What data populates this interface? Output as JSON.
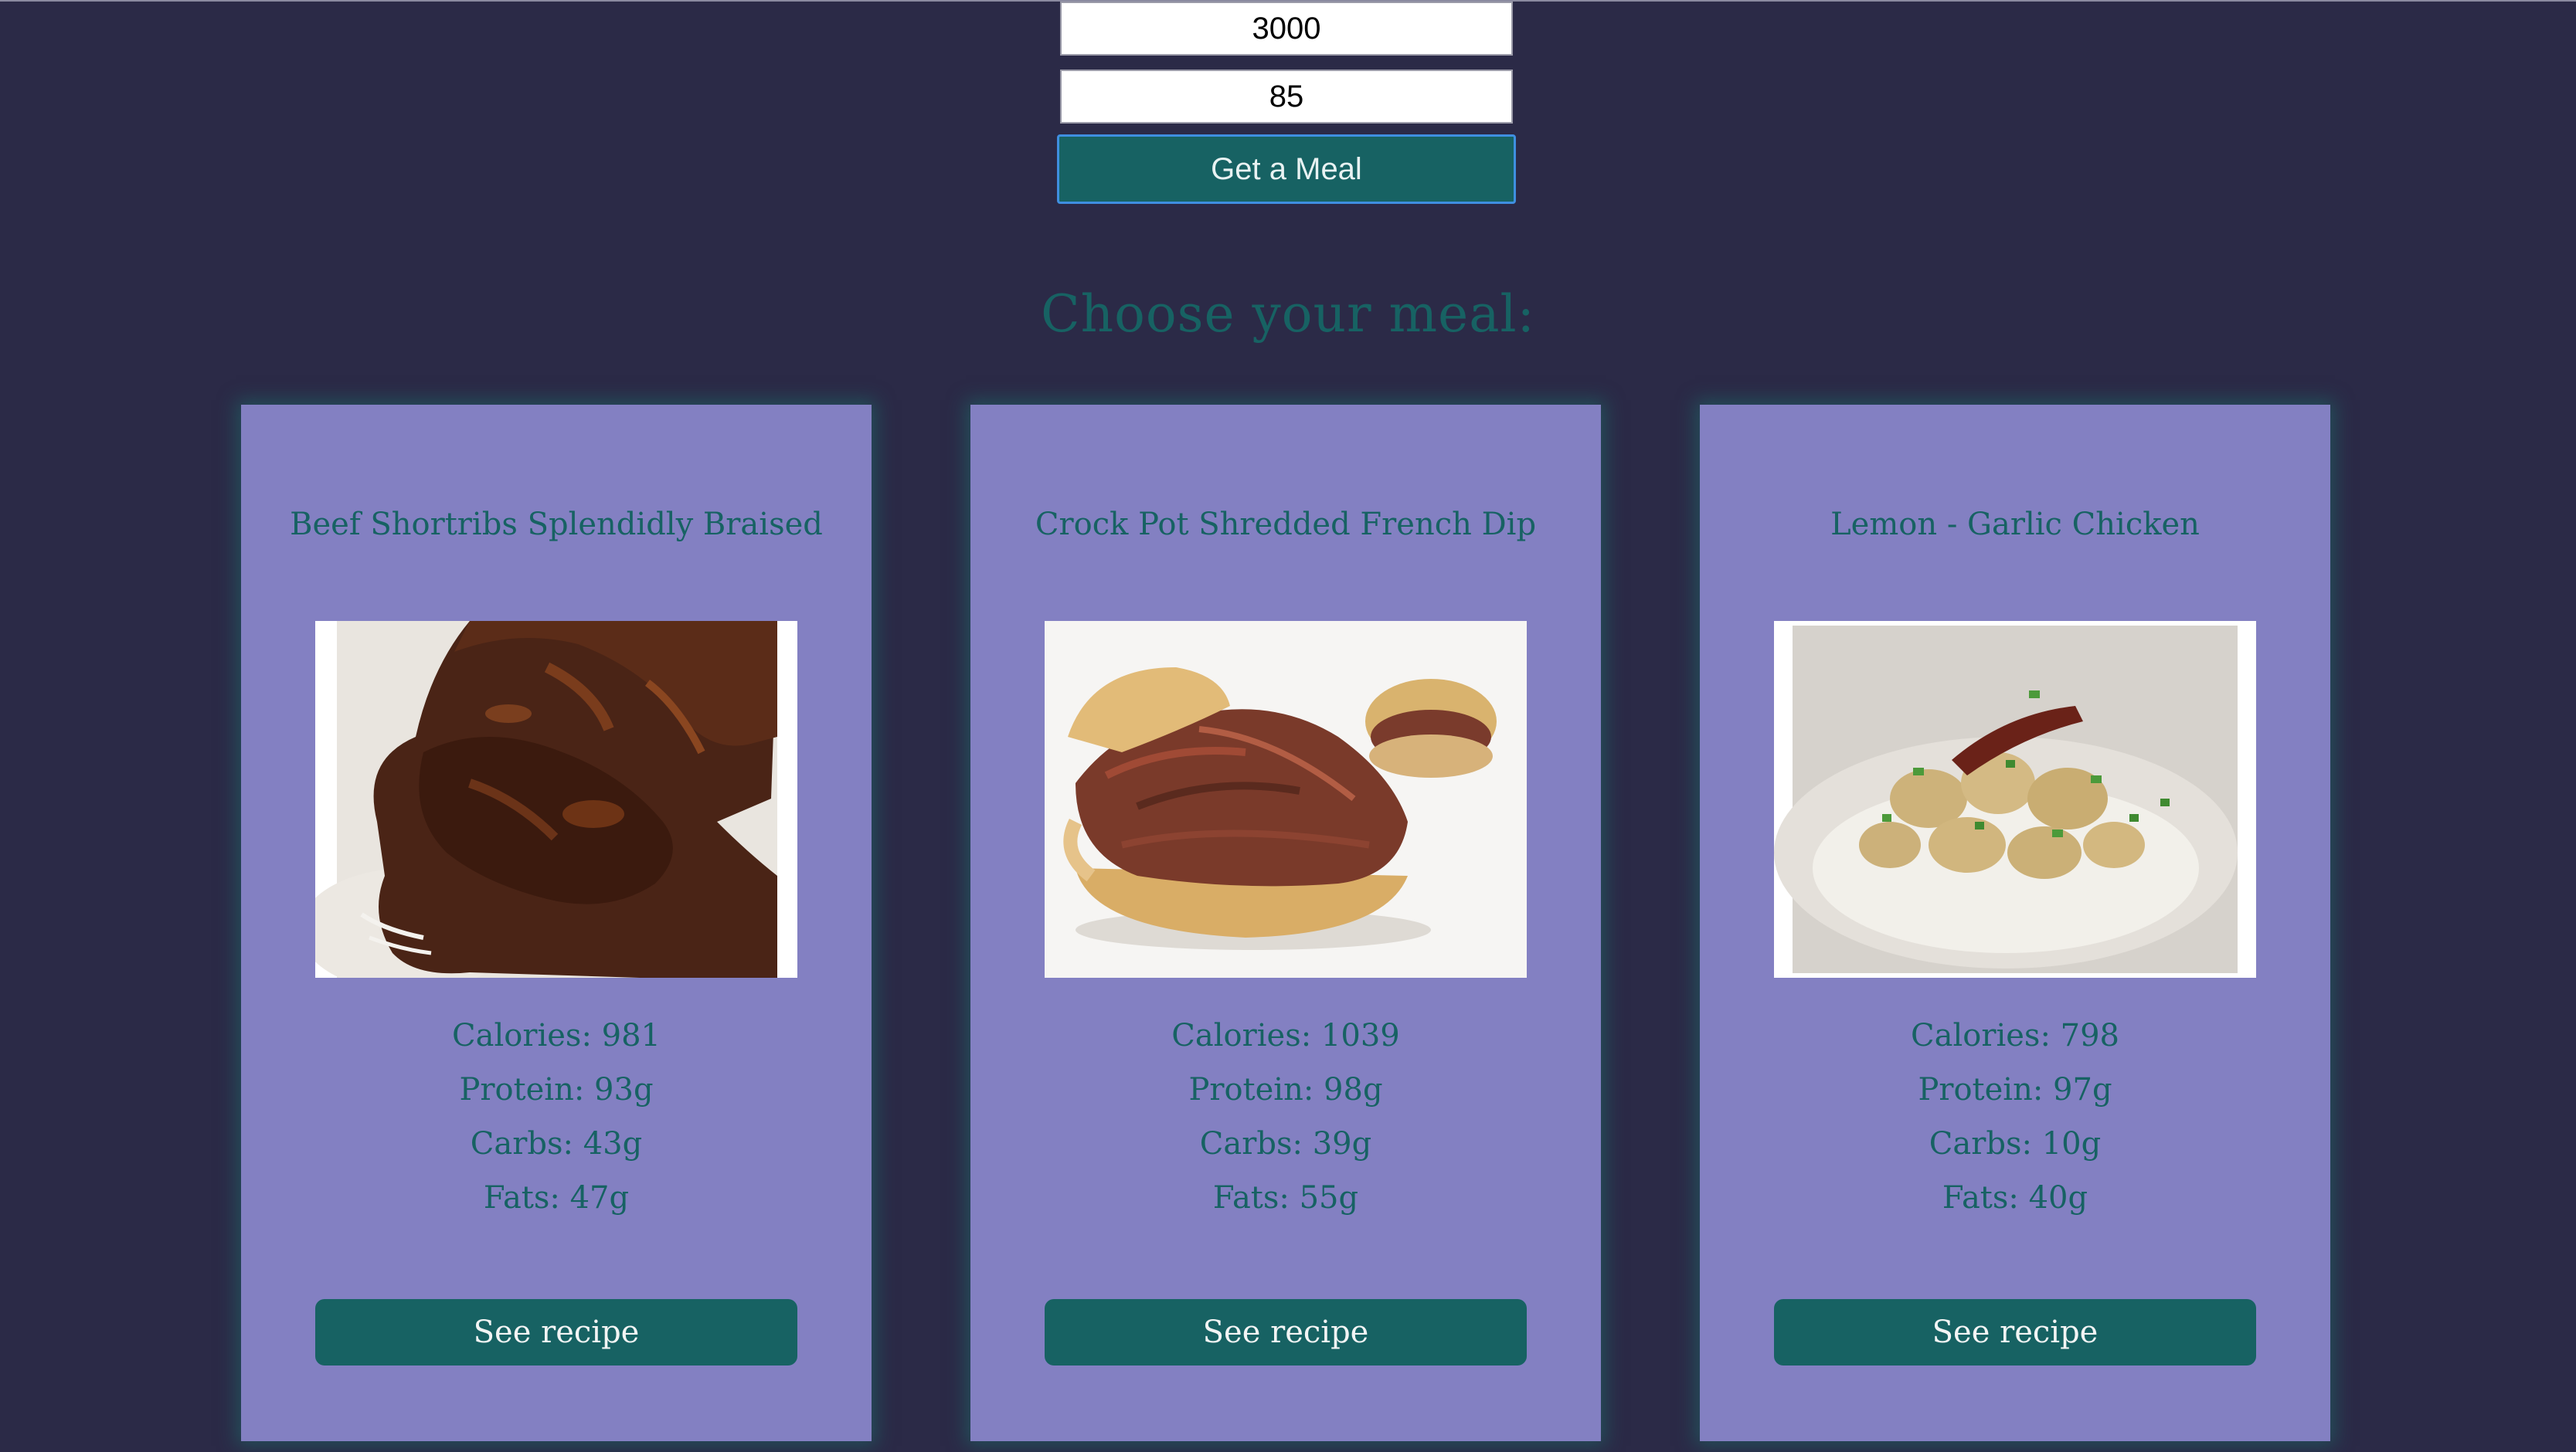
{
  "form": {
    "calories_value": "3000",
    "protein_value": "85",
    "submit_label": "Get a Meal"
  },
  "section_title": "Choose your meal:",
  "meals": [
    {
      "title": "Beef Shortribs Splendidly Braised",
      "image": "braised-beef-photo",
      "calories": "Calories: 981",
      "protein": "Protein: 93g",
      "carbs": "Carbs: 43g",
      "fats": "Fats: 47g",
      "button_label": "See recipe"
    },
    {
      "title": "Crock Pot Shredded French Dip",
      "image": "french-dip-sandwich-photo",
      "calories": "Calories: 1039",
      "protein": "Protein: 98g",
      "carbs": "Carbs: 39g",
      "fats": "Fats: 55g",
      "button_label": "See recipe"
    },
    {
      "title": "Lemon - Garlic Chicken",
      "image": "chicken-rice-photo",
      "calories": "Calories: 798",
      "protein": "Protein: 97g",
      "carbs": "Carbs: 10g",
      "fats": "Fats: 40g",
      "button_label": "See recipe"
    }
  ],
  "colors": {
    "background": "#2b2a47",
    "card": "#8380c2",
    "accent": "#176263"
  }
}
